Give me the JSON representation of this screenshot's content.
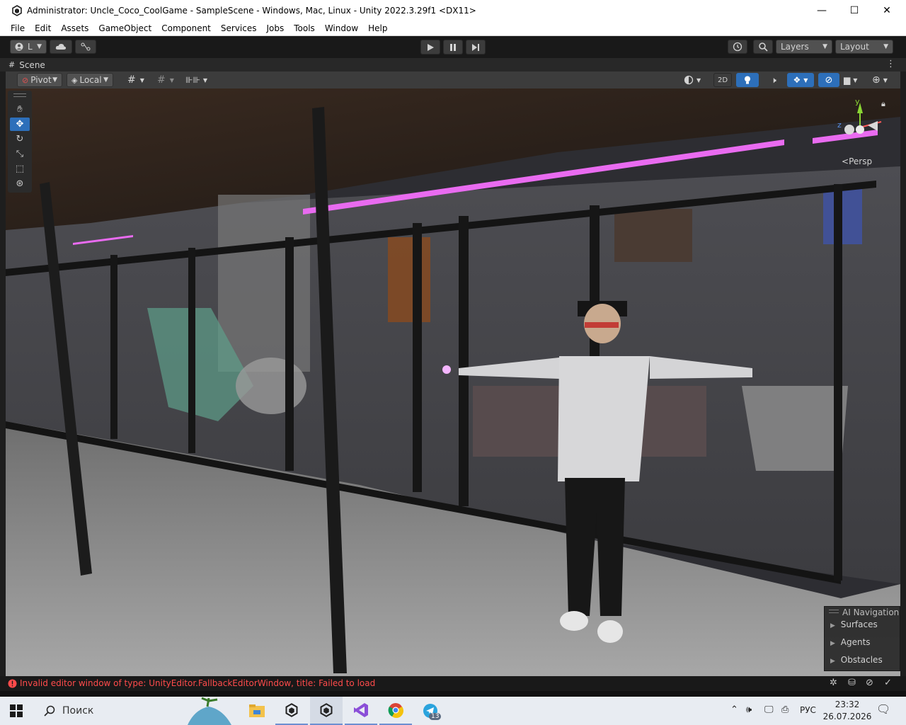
{
  "window": {
    "title": "Administrator: Uncle_Coco_CoolGame - SampleScene - Windows, Mac, Linux - Unity 2022.3.29f1 <DX11>",
    "icon": "unity-icon",
    "controls": {
      "minimize": "—",
      "maximize": "☐",
      "close": "✕"
    }
  },
  "menu": {
    "items": [
      "File",
      "Edit",
      "Assets",
      "GameObject",
      "Component",
      "Services",
      "Jobs",
      "Tools",
      "Window",
      "Help"
    ]
  },
  "toolbar": {
    "account_label": "L",
    "layers_label": "Layers",
    "layout_label": "Layout"
  },
  "scene_tab": {
    "label": "Scene"
  },
  "scene_toolbar": {
    "pivot_label": "Pivot",
    "local_label": "Local",
    "mode_2d_label": "2D"
  },
  "gizmo": {
    "projection_label": "Persp",
    "axis_y": "y",
    "axis_z": "z"
  },
  "ai_navigation": {
    "title": "AI Navigation",
    "items": [
      "Surfaces",
      "Agents",
      "Obstacles"
    ]
  },
  "status": {
    "error_text": "Invalid editor window of type: UnityEditor.FallbackEditorWindow, title: Failed to load"
  },
  "taskbar": {
    "search_placeholder": "Поиск",
    "language": "РУС",
    "time": "23:32",
    "date": "26.07.2026",
    "telegram_badge": "13"
  },
  "colors": {
    "accent_blue": "#2d6fba",
    "neon_pink": "#e96bf0",
    "error_red": "#ff4b4b"
  }
}
